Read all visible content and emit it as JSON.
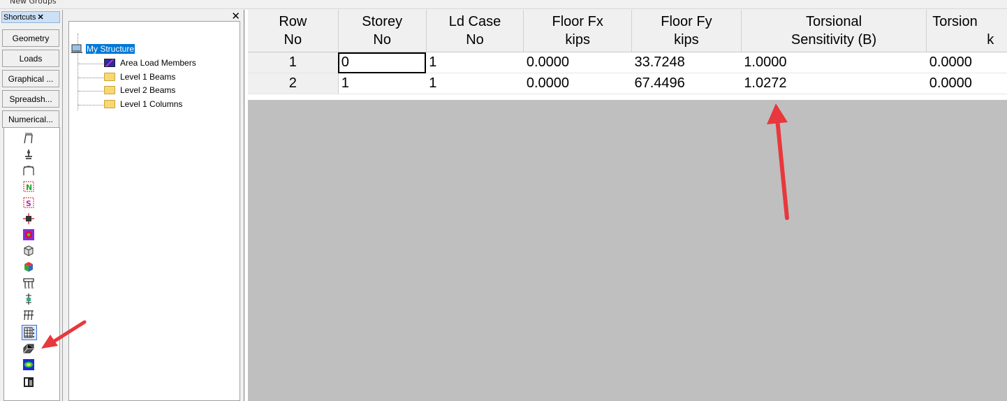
{
  "topbar": {
    "label": "New Groups"
  },
  "shortcuts": {
    "title": "Shortcuts",
    "buttons": [
      "Geometry",
      "Loads",
      "Graphical ...",
      "Spreadsh...",
      "Numerical..."
    ]
  },
  "tree": {
    "root": "My Structure",
    "children": [
      "Area Load Members",
      "Level 1 Beams",
      "Level 2 Beams",
      "Level 1 Columns"
    ]
  },
  "table": {
    "headers": [
      {
        "l1": "Row",
        "l2": "No"
      },
      {
        "l1": "Storey",
        "l2": "No"
      },
      {
        "l1": "Ld Case",
        "l2": "No"
      },
      {
        "l1": "Floor Fx",
        "l2": "kips"
      },
      {
        "l1": "Floor Fy",
        "l2": "kips"
      },
      {
        "l1": "Torsional",
        "l2": "Sensitivity (B)"
      },
      {
        "l1": "Torsion",
        "l2": "k"
      }
    ],
    "rows": [
      [
        "1",
        "0",
        "1",
        "0.0000",
        "33.7248",
        "1.0000",
        "0.0000"
      ],
      [
        "2",
        "1",
        "1",
        "0.0000",
        "67.4496",
        "1.0272",
        "0.0000"
      ]
    ]
  },
  "colors": {
    "selection": "#0078d7",
    "annotation_arrow": "#e8383d",
    "empty_area": "#bfbfbf"
  }
}
